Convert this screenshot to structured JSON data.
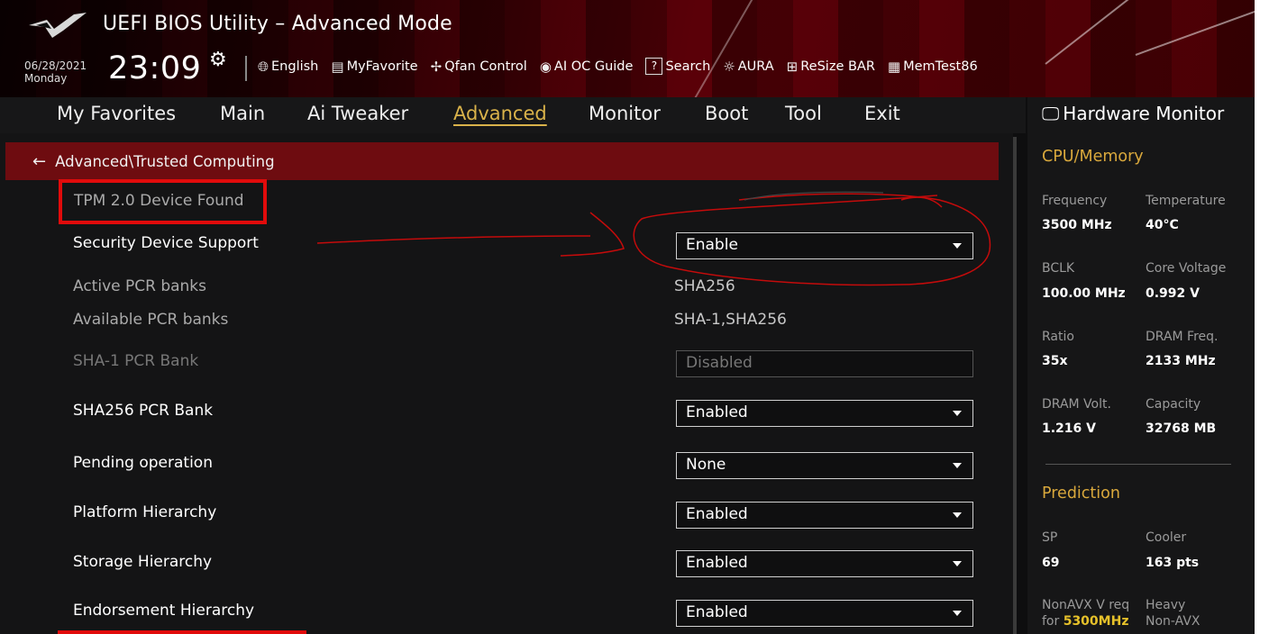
{
  "header": {
    "title": "UEFI BIOS Utility – Advanced Mode",
    "date": "06/28/2021",
    "day": "Monday",
    "time": "23:09",
    "toolbar": [
      {
        "icon": "globe-icon",
        "label": "English"
      },
      {
        "icon": "favorite-icon",
        "label": "MyFavorite"
      },
      {
        "icon": "fan-icon",
        "label": "Qfan Control"
      },
      {
        "icon": "ai-oc-icon",
        "label": "AI OC Guide"
      },
      {
        "icon": "search-icon",
        "label": "Search"
      },
      {
        "icon": "aura-icon",
        "label": "AURA"
      },
      {
        "icon": "resize-bar-icon",
        "label": "ReSize BAR"
      },
      {
        "icon": "memtest-icon",
        "label": "MemTest86"
      }
    ]
  },
  "nav": {
    "tabs": [
      "My Favorites",
      "Main",
      "Ai Tweaker",
      "Advanced",
      "Monitor",
      "Boot",
      "Tool",
      "Exit"
    ],
    "active": "Advanced"
  },
  "breadcrumb": "Advanced\\Trusted Computing",
  "settings": {
    "tpm_found": "TPM 2.0 Device Found",
    "security_device_support": {
      "label": "Security Device Support",
      "value": "Enable"
    },
    "active_pcr_banks": {
      "label": "Active PCR banks",
      "value": "SHA256"
    },
    "available_pcr_banks": {
      "label": "Available PCR banks",
      "value": "SHA-1,SHA256"
    },
    "sha1_pcr_bank": {
      "label": "SHA-1 PCR Bank",
      "value": "Disabled"
    },
    "sha256_pcr_bank": {
      "label": "SHA256 PCR Bank",
      "value": "Enabled"
    },
    "pending_operation": {
      "label": "Pending operation",
      "value": "None"
    },
    "platform_hierarchy": {
      "label": "Platform Hierarchy",
      "value": "Enabled"
    },
    "storage_hierarchy": {
      "label": "Storage Hierarchy",
      "value": "Enabled"
    },
    "endorsement_hierarchy": {
      "label": "Endorsement Hierarchy",
      "value": "Enabled"
    }
  },
  "hardware_monitor": {
    "title": "Hardware Monitor",
    "cpu_memory": {
      "heading": "CPU/Memory",
      "frequency": {
        "label": "Frequency",
        "value": "3500 MHz"
      },
      "temperature": {
        "label": "Temperature",
        "value": "40°C"
      },
      "bclk": {
        "label": "BCLK",
        "value": "100.00 MHz"
      },
      "core_voltage": {
        "label": "Core Voltage",
        "value": "0.992 V"
      },
      "ratio": {
        "label": "Ratio",
        "value": "35x"
      },
      "dram_freq": {
        "label": "DRAM Freq.",
        "value": "2133 MHz"
      },
      "dram_volt": {
        "label": "DRAM Volt.",
        "value": "1.216 V"
      },
      "capacity": {
        "label": "Capacity",
        "value": "32768 MB"
      }
    },
    "prediction": {
      "heading": "Prediction",
      "sp": {
        "label": "SP",
        "value": "69"
      },
      "cooler": {
        "label": "Cooler",
        "value": "163 pts"
      },
      "nonavx_label": "NonAVX V req",
      "nonavx_for": "for",
      "nonavx_freq": "5300MHz",
      "heavy": "Heavy",
      "non_avx": "Non-AVX"
    }
  },
  "colors": {
    "accent_gold": "#d9b24a",
    "section_orange": "#d9a83c",
    "breadcrumb_bg": "#6e0c10",
    "annotation_red": "#e10b0b"
  }
}
